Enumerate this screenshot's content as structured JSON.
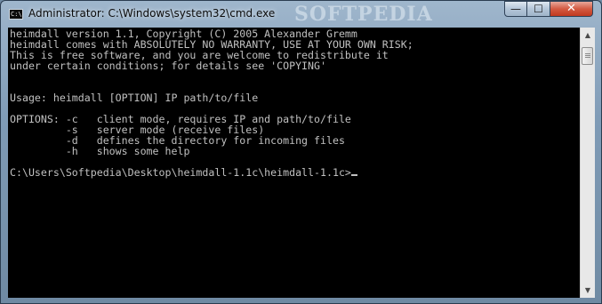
{
  "window": {
    "title": "Administrator: C:\\Windows\\system32\\cmd.exe",
    "icon_label": "C:\\",
    "watermark": "SOFTPEDIA",
    "controls": {
      "minimize": "—",
      "maximize": "☐",
      "close": "✕"
    }
  },
  "console": {
    "lines": [
      "heimdall version 1.1, Copyright (C) 2005 Alexander Gremm",
      "heimdall comes with ABSOLUTELY NO WARRANTY, USE AT YOUR OWN RISK;",
      "This is free software, and you are welcome to redistribute it",
      "under certain conditions; for details see 'COPYING'",
      "",
      "",
      "Usage: heimdall [OPTION] IP path/to/file",
      "",
      "OPTIONS: -c   client mode, requires IP and path/to/file",
      "         -s   server mode (receive files)",
      "         -d   defines the directory for incoming files",
      "         -h   shows some help",
      ""
    ],
    "prompt": "C:\\Users\\Softpedia\\Desktop\\heimdall-1.1c\\heimdall-1.1c>"
  },
  "scrollbar": {
    "up_arrow": "▲",
    "down_arrow": "▼"
  }
}
